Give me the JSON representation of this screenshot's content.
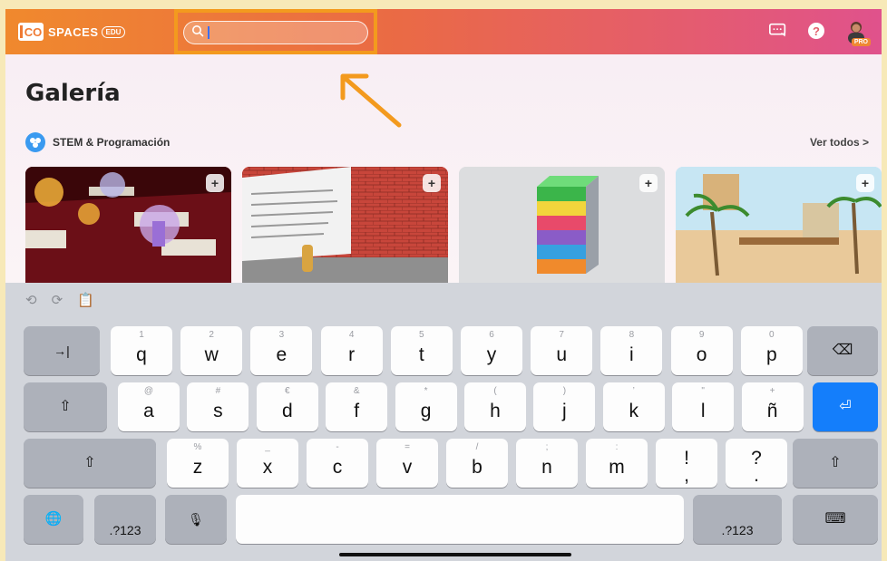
{
  "app": {
    "logo_text": "SPACES",
    "logo_mark": "CO",
    "logo_badge": "EDU",
    "search_placeholder": ""
  },
  "header": {
    "help_label": "?",
    "pro_badge": "PRO"
  },
  "page": {
    "title": "Galería",
    "section_title": "STEM & Programación",
    "see_all": "Ver todos  >"
  },
  "keyboard": {
    "row1": [
      {
        "sub": "1",
        "main": "q"
      },
      {
        "sub": "2",
        "main": "w"
      },
      {
        "sub": "3",
        "main": "e"
      },
      {
        "sub": "4",
        "main": "r"
      },
      {
        "sub": "5",
        "main": "t"
      },
      {
        "sub": "6",
        "main": "y"
      },
      {
        "sub": "7",
        "main": "u"
      },
      {
        "sub": "8",
        "main": "i"
      },
      {
        "sub": "9",
        "main": "o"
      },
      {
        "sub": "0",
        "main": "p"
      }
    ],
    "row2": [
      {
        "sub": "@",
        "main": "a"
      },
      {
        "sub": "#",
        "main": "s"
      },
      {
        "sub": "€",
        "main": "d"
      },
      {
        "sub": "&",
        "main": "f"
      },
      {
        "sub": "*",
        "main": "g"
      },
      {
        "sub": "(",
        "main": "h"
      },
      {
        "sub": ")",
        "main": "j"
      },
      {
        "sub": "’",
        "main": "k"
      },
      {
        "sub": "\"",
        "main": "l"
      },
      {
        "sub": "+",
        "main": "ñ"
      }
    ],
    "row3": [
      {
        "sub": "%",
        "main": "z"
      },
      {
        "sub": "_",
        "main": "x"
      },
      {
        "sub": "-",
        "main": "c"
      },
      {
        "sub": "=",
        "main": "v"
      },
      {
        "sub": "/",
        "main": "b"
      },
      {
        "sub": ";",
        "main": "n"
      },
      {
        "sub": ":",
        "main": "m"
      },
      {
        "sub": "",
        "main": "!\n,"
      },
      {
        "sub": "",
        "main": "?\n."
      }
    ],
    "num_label": ".?123",
    "tab_symbol": "→|",
    "delete_symbol": "⌫",
    "return_symbol": "⏎",
    "shift_symbol": "⇧"
  }
}
